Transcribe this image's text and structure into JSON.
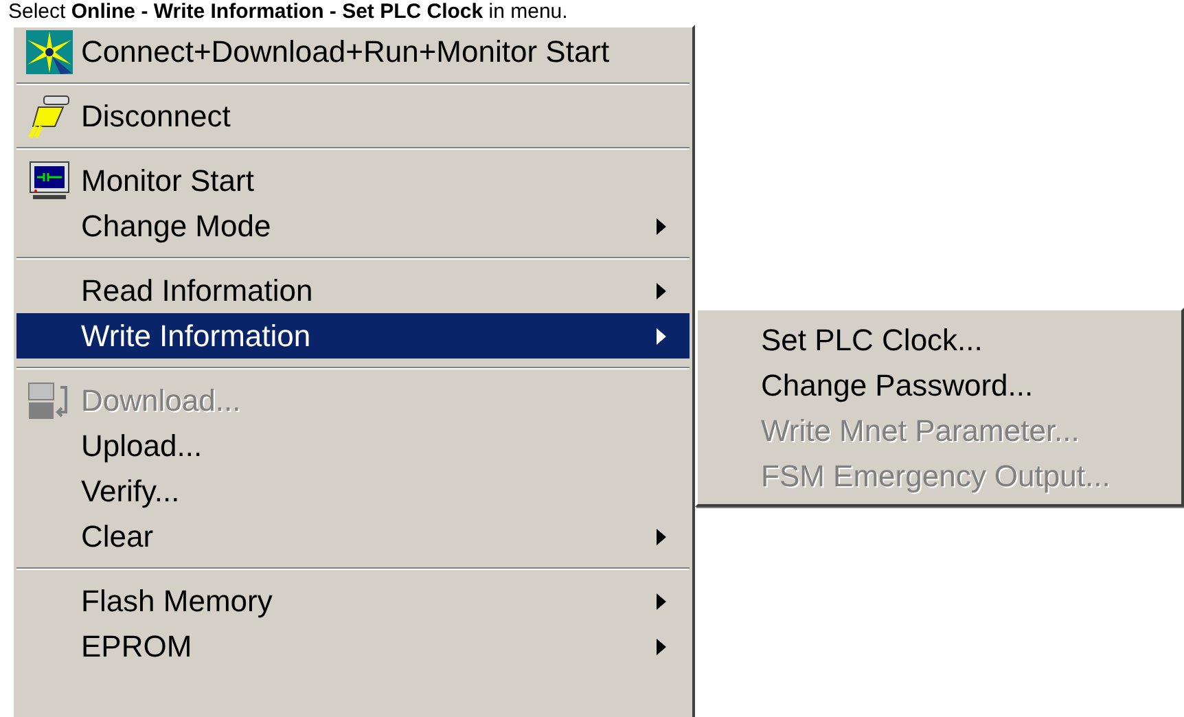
{
  "caption": "Select **Online - Write Information - Set PLC Clock** in menu.",
  "menu": {
    "items": [
      {
        "kind": "item",
        "label": "Connect+Download+Run+Monitor Start",
        "submenu": false,
        "disabled": false,
        "selected": false
      },
      {
        "kind": "separator"
      },
      {
        "kind": "item",
        "label": "Disconnect",
        "submenu": false,
        "disabled": false,
        "selected": false
      },
      {
        "kind": "separator"
      },
      {
        "kind": "item",
        "label": "Monitor Start",
        "submenu": false,
        "disabled": false,
        "selected": false
      },
      {
        "kind": "item",
        "label": "Change Mode",
        "submenu": true,
        "disabled": false,
        "selected": false
      },
      {
        "kind": "separator"
      },
      {
        "kind": "item",
        "label": "Read Information",
        "submenu": true,
        "disabled": false,
        "selected": false
      },
      {
        "kind": "item",
        "label": "Write Information",
        "submenu": true,
        "disabled": false,
        "selected": true
      },
      {
        "kind": "separator"
      },
      {
        "kind": "item",
        "label": "Download...",
        "submenu": false,
        "disabled": true,
        "selected": false
      },
      {
        "kind": "item",
        "label": "Upload...",
        "submenu": false,
        "disabled": false,
        "selected": false
      },
      {
        "kind": "item",
        "label": "Verify...",
        "submenu": false,
        "disabled": false,
        "selected": false
      },
      {
        "kind": "item",
        "label": "Clear",
        "submenu": true,
        "disabled": false,
        "selected": false
      },
      {
        "kind": "separator"
      },
      {
        "kind": "item",
        "label": "Flash Memory",
        "submenu": true,
        "disabled": false,
        "selected": false
      },
      {
        "kind": "item",
        "label": "EPROM",
        "submenu": true,
        "disabled": false,
        "selected": false
      }
    ]
  },
  "submenu": {
    "items": [
      {
        "label": "Set PLC Clock...",
        "disabled": false
      },
      {
        "label": "Change Password...",
        "disabled": false
      },
      {
        "label": "Write Mnet Parameter...",
        "disabled": true
      },
      {
        "label": "FSM Emergency Output...",
        "disabled": true
      }
    ]
  }
}
